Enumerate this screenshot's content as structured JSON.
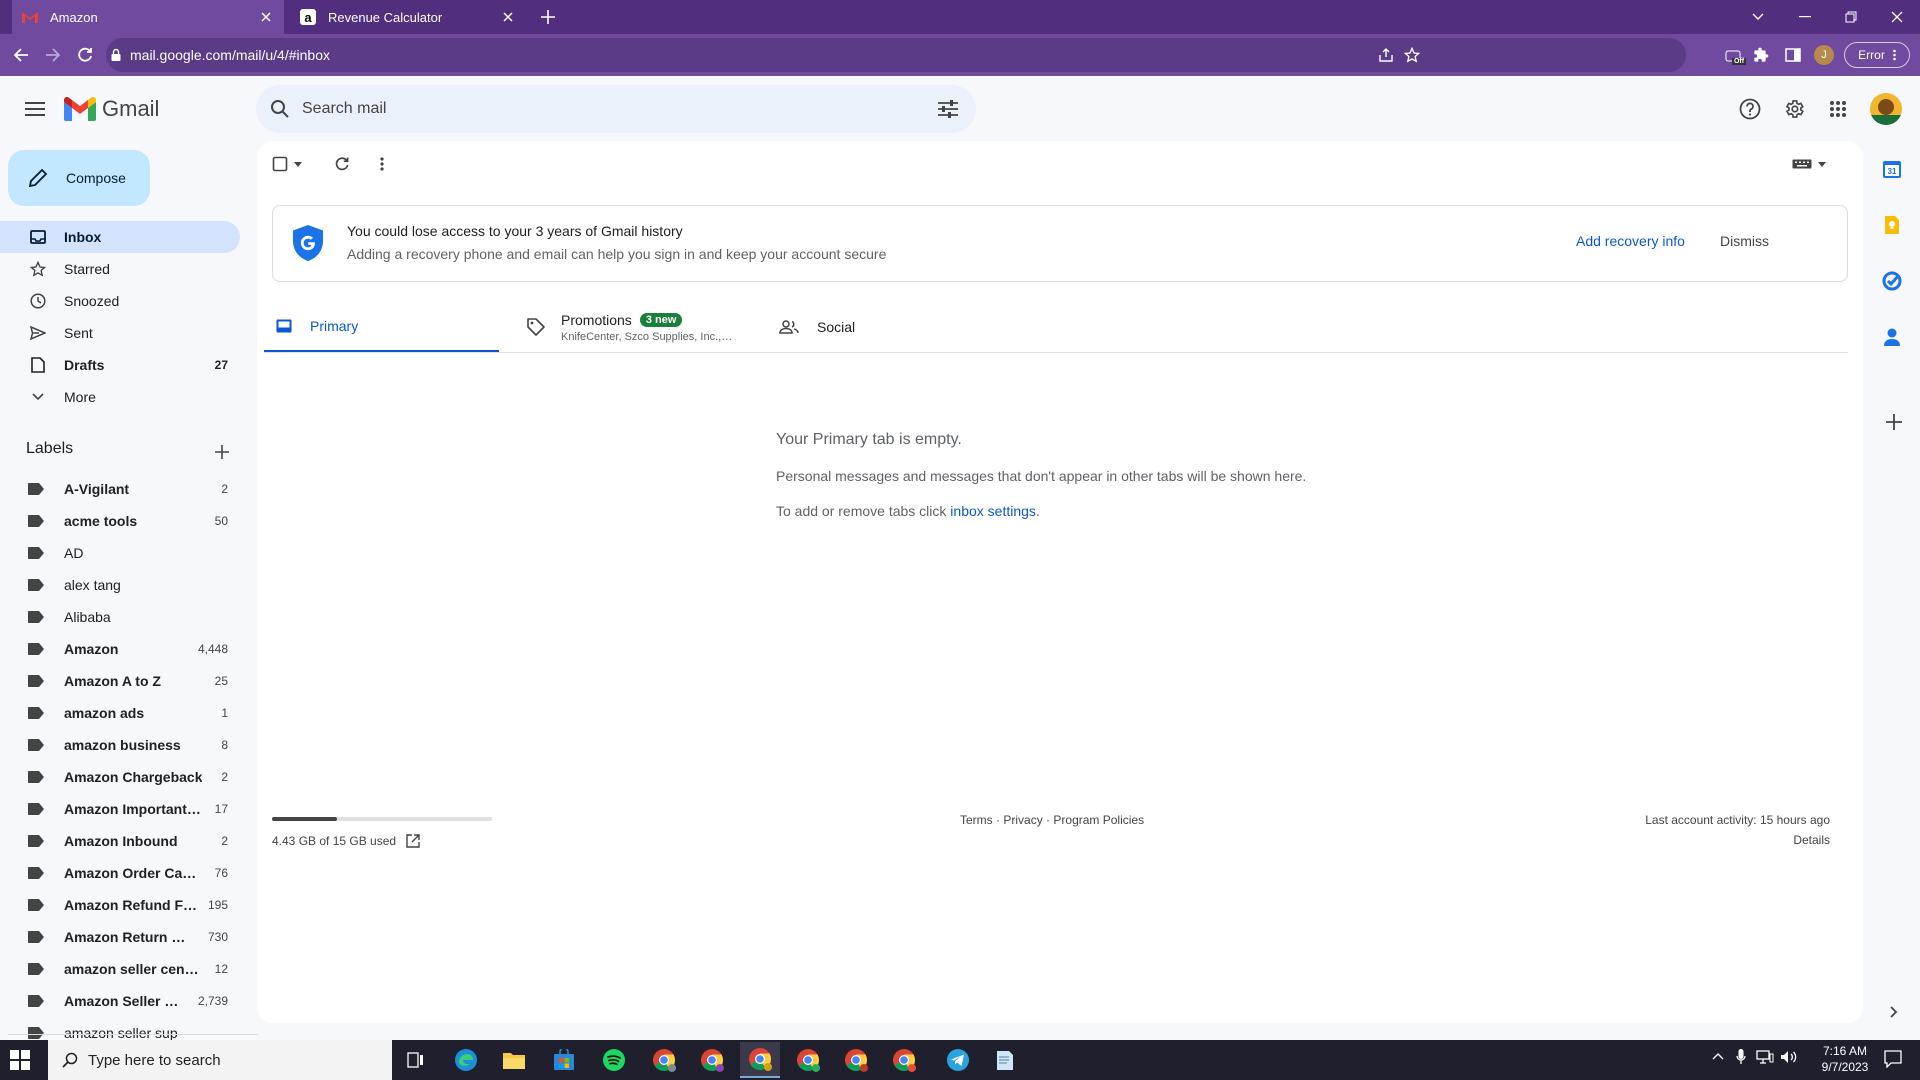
{
  "browser": {
    "tabs": [
      {
        "title": "Amazon",
        "favicon": "gmail-m"
      },
      {
        "title": "Revenue Calculator",
        "favicon": "amazon-a"
      }
    ],
    "new_tab_symbol": "+",
    "url": "mail.google.com/mail/u/4/#inbox",
    "profile_initial": "J",
    "error_label": "Error",
    "extension_badge": "Off"
  },
  "gmail": {
    "product_name": "Gmail",
    "search_placeholder": "Search mail",
    "compose_label": "Compose",
    "nav": [
      {
        "label": "Inbox",
        "count": "",
        "icon": "inbox-icon"
      },
      {
        "label": "Starred",
        "count": "",
        "icon": "star-icon"
      },
      {
        "label": "Snoozed",
        "count": "",
        "icon": "clock-icon"
      },
      {
        "label": "Sent",
        "count": "",
        "icon": "send-icon"
      },
      {
        "label": "Drafts",
        "count": "27",
        "icon": "draft-icon"
      },
      {
        "label": "More",
        "count": "",
        "icon": "chevron-down-icon"
      }
    ],
    "labels_heading": "Labels",
    "labels": [
      {
        "label": "A-Vigilant",
        "count": "2"
      },
      {
        "label": "acme tools",
        "count": "50"
      },
      {
        "label": "AD",
        "count": ""
      },
      {
        "label": "alex tang",
        "count": ""
      },
      {
        "label": "Alibaba",
        "count": ""
      },
      {
        "label": "Amazon",
        "count": "4,448"
      },
      {
        "label": "Amazon A to Z",
        "count": "25"
      },
      {
        "label": "amazon ads",
        "count": "1"
      },
      {
        "label": "amazon business",
        "count": "8"
      },
      {
        "label": "Amazon Chargeback",
        "count": "2"
      },
      {
        "label": "Amazon Important…",
        "count": "17"
      },
      {
        "label": "Amazon Inbound",
        "count": "2"
      },
      {
        "label": "Amazon Order Ca…",
        "count": "76"
      },
      {
        "label": "Amazon Refund F…",
        "count": "195"
      },
      {
        "label": "Amazon Return …",
        "count": "730"
      },
      {
        "label": "amazon seller cen…",
        "count": "12"
      },
      {
        "label": "Amazon Seller …",
        "count": "2,739"
      },
      {
        "label": "amazon seller sup",
        "count": ""
      }
    ],
    "banner": {
      "title": "You could lose access to your 3 years of Gmail history",
      "subtitle": "Adding a recovery phone and email can help you sign in and keep your account secure",
      "action": "Add recovery info",
      "dismiss": "Dismiss"
    },
    "tabs": {
      "primary": "Primary",
      "promotions": "Promotions",
      "promotions_badge": "3 new",
      "promotions_snippet": "KnifeCenter, Szco Supplies, Inc.,…",
      "social": "Social"
    },
    "empty": {
      "title": "Your Primary tab is empty.",
      "line1": "Personal messages and messages that don't appear in other tabs will be shown here.",
      "line2_prefix": "To add or remove tabs click ",
      "line2_link": "inbox settings",
      "line2_suffix": "."
    },
    "footer": {
      "storage": "4.43 GB of 15 GB used",
      "storage_fraction": 0.295,
      "terms": "Terms",
      "sep": "·",
      "privacy": "Privacy",
      "policies": "Program Policies",
      "activity": "Last account activity: 15 hours ago",
      "details": "Details"
    }
  },
  "taskbar": {
    "search_placeholder": "Type here to search",
    "time": "7:16 AM",
    "date": "9/7/2023",
    "apps": [
      "task-view",
      "edge",
      "file-explorer",
      "store",
      "spotify",
      "chrome",
      "chrome",
      "chrome",
      "chrome",
      "chrome",
      "chrome",
      "telegram",
      "notepad"
    ]
  }
}
